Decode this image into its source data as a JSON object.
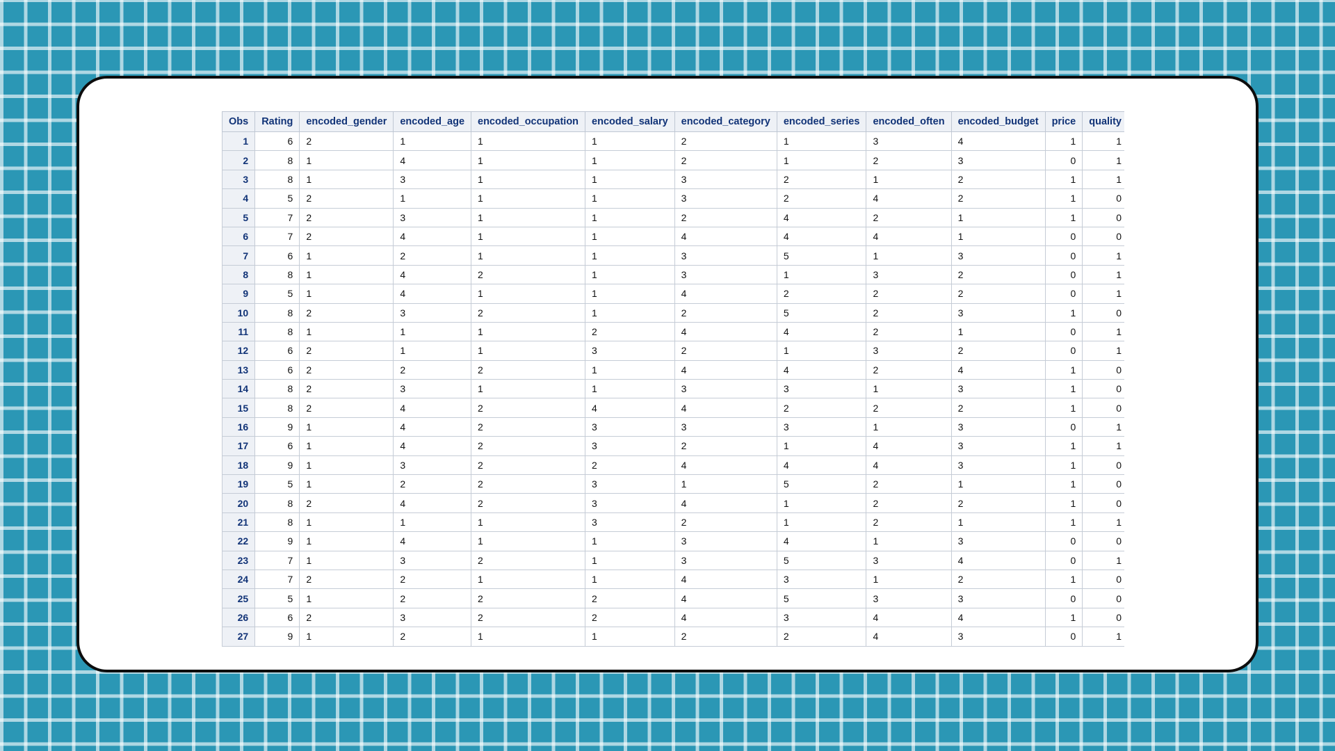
{
  "table": {
    "columns": [
      "Obs",
      "Rating",
      "encoded_gender",
      "encoded_age",
      "encoded_occupation",
      "encoded_salary",
      "encoded_category",
      "encoded_series",
      "encoded_often",
      "encoded_budget",
      "price",
      "quality"
    ],
    "rows": [
      [
        "1",
        "6",
        "2",
        "1",
        "1",
        "1",
        "2",
        "1",
        "3",
        "4",
        "1",
        "1"
      ],
      [
        "2",
        "8",
        "1",
        "4",
        "1",
        "1",
        "2",
        "1",
        "2",
        "3",
        "0",
        "1"
      ],
      [
        "3",
        "8",
        "1",
        "3",
        "1",
        "1",
        "3",
        "2",
        "1",
        "2",
        "1",
        "1"
      ],
      [
        "4",
        "5",
        "2",
        "1",
        "1",
        "1",
        "3",
        "2",
        "4",
        "2",
        "1",
        "0"
      ],
      [
        "5",
        "7",
        "2",
        "3",
        "1",
        "1",
        "2",
        "4",
        "2",
        "1",
        "1",
        "0"
      ],
      [
        "6",
        "7",
        "2",
        "4",
        "1",
        "1",
        "4",
        "4",
        "4",
        "1",
        "0",
        "0"
      ],
      [
        "7",
        "6",
        "1",
        "2",
        "1",
        "1",
        "3",
        "5",
        "1",
        "3",
        "0",
        "1"
      ],
      [
        "8",
        "8",
        "1",
        "4",
        "2",
        "1",
        "3",
        "1",
        "3",
        "2",
        "0",
        "1"
      ],
      [
        "9",
        "5",
        "1",
        "4",
        "1",
        "1",
        "4",
        "2",
        "2",
        "2",
        "0",
        "1"
      ],
      [
        "10",
        "8",
        "2",
        "3",
        "2",
        "1",
        "2",
        "5",
        "2",
        "3",
        "1",
        "0"
      ],
      [
        "11",
        "8",
        "1",
        "1",
        "1",
        "2",
        "4",
        "4",
        "2",
        "1",
        "0",
        "1"
      ],
      [
        "12",
        "6",
        "2",
        "1",
        "1",
        "3",
        "2",
        "1",
        "3",
        "2",
        "0",
        "1"
      ],
      [
        "13",
        "6",
        "2",
        "2",
        "2",
        "1",
        "4",
        "4",
        "2",
        "4",
        "1",
        "0"
      ],
      [
        "14",
        "8",
        "2",
        "3",
        "1",
        "1",
        "3",
        "3",
        "1",
        "3",
        "1",
        "0"
      ],
      [
        "15",
        "8",
        "2",
        "4",
        "2",
        "4",
        "4",
        "2",
        "2",
        "2",
        "1",
        "0"
      ],
      [
        "16",
        "9",
        "1",
        "4",
        "2",
        "3",
        "3",
        "3",
        "1",
        "3",
        "0",
        "1"
      ],
      [
        "17",
        "6",
        "1",
        "4",
        "2",
        "3",
        "2",
        "1",
        "4",
        "3",
        "1",
        "1"
      ],
      [
        "18",
        "9",
        "1",
        "3",
        "2",
        "2",
        "4",
        "4",
        "4",
        "3",
        "1",
        "0"
      ],
      [
        "19",
        "5",
        "1",
        "2",
        "2",
        "3",
        "1",
        "5",
        "2",
        "1",
        "1",
        "0"
      ],
      [
        "20",
        "8",
        "2",
        "4",
        "2",
        "3",
        "4",
        "1",
        "2",
        "2",
        "1",
        "0"
      ],
      [
        "21",
        "8",
        "1",
        "1",
        "1",
        "3",
        "2",
        "1",
        "2",
        "1",
        "1",
        "1"
      ],
      [
        "22",
        "9",
        "1",
        "4",
        "1",
        "1",
        "3",
        "4",
        "1",
        "3",
        "0",
        "0"
      ],
      [
        "23",
        "7",
        "1",
        "3",
        "2",
        "1",
        "3",
        "5",
        "3",
        "4",
        "0",
        "1"
      ],
      [
        "24",
        "7",
        "2",
        "2",
        "1",
        "1",
        "4",
        "3",
        "1",
        "2",
        "1",
        "0"
      ],
      [
        "25",
        "5",
        "1",
        "2",
        "2",
        "2",
        "4",
        "5",
        "3",
        "3",
        "0",
        "0"
      ],
      [
        "26",
        "6",
        "2",
        "3",
        "2",
        "2",
        "4",
        "3",
        "4",
        "4",
        "1",
        "0"
      ],
      [
        "27",
        "9",
        "1",
        "2",
        "1",
        "1",
        "2",
        "2",
        "4",
        "3",
        "0",
        "1"
      ]
    ]
  }
}
